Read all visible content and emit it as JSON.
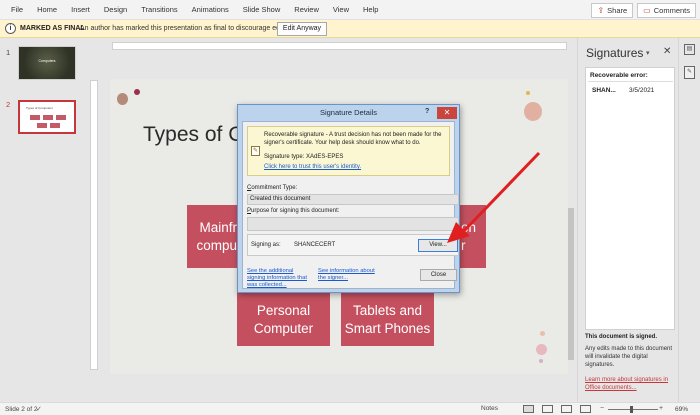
{
  "ribbon": {
    "tabs": [
      "File",
      "Home",
      "Insert",
      "Design",
      "Transitions",
      "Animations",
      "Slide Show",
      "Review",
      "View",
      "Help"
    ],
    "share_label": "Share",
    "comments_label": "Comments"
  },
  "message_bar": {
    "title": "MARKED AS FINAL",
    "text": "An author has marked this presentation as final to discourage editing.",
    "button_label": "Edit Anyway"
  },
  "thumbnails": {
    "items": [
      {
        "number": "1",
        "title": "Computers"
      },
      {
        "number": "2",
        "title": "Types of Computers"
      }
    ],
    "selected": "2"
  },
  "slide": {
    "title": "Types of Co",
    "boxes": [
      {
        "line1": "Mainfr",
        "line2": "compu"
      },
      {
        "line1": "on",
        "line2": "r"
      },
      {
        "line1": "Personal",
        "line2": "Computer"
      },
      {
        "line1": "Tablets and",
        "line2": "Smart Phones"
      }
    ]
  },
  "dialog": {
    "title": "Signature Details",
    "help_glyph": "?",
    "close_glyph": "✕",
    "warning_text": "Recoverable signature - A trust decision has not been made for the signer's certificate. Your help desk should know what to do.",
    "signature_type": "Signature type: XAdES-EPES",
    "trust_link": "Click here to trust this user's identity.",
    "commitment_label_prefix": "C",
    "commitment_label_rest": "ommitment Type:",
    "commitment_value": "Created this document",
    "purpose_label_prefix": "P",
    "purpose_label_rest": "urpose for signing this document:",
    "purpose_value": "",
    "signing_as_label": "Signing as:",
    "signer": "SHANCECERT",
    "view_button": "View...",
    "additional_link": "See the additional signing information that was collected...",
    "about_signer_link": "See information about the signer...",
    "close_button": "Close"
  },
  "signatures_pane": {
    "title": "Signatures",
    "dropdown_glyph": "▾",
    "close_glyph": "✕",
    "section": "Recoverable error:",
    "entries": [
      {
        "signer": "SHAN...",
        "date": "3/5/2021"
      }
    ],
    "signed_heading": "This document is signed.",
    "note": "Any edits made to this document will invalidate the digital signatures.",
    "learn_link": "Learn more about signatures in Office documents..."
  },
  "status_bar": {
    "slide_indicator": "Slide 2 of 2",
    "notes_label": "Notes",
    "zoom": "69%"
  },
  "colors": {
    "accent": "#b7472a",
    "slide_box": "#c4505f",
    "message_bar": "#fff4ce",
    "dialog_frame": "#bcd3ee",
    "arrow": "#e02020",
    "link": "#1a5ad0"
  },
  "icons": [
    "info-icon",
    "share-icon",
    "comments-icon",
    "signature-warning-icon",
    "sidebar-signature-icon",
    "sidebar-document-icon",
    "spell-check-icon",
    "normal-view-icon",
    "sorter-view-icon",
    "reading-view-icon",
    "slideshow-view-icon"
  ]
}
